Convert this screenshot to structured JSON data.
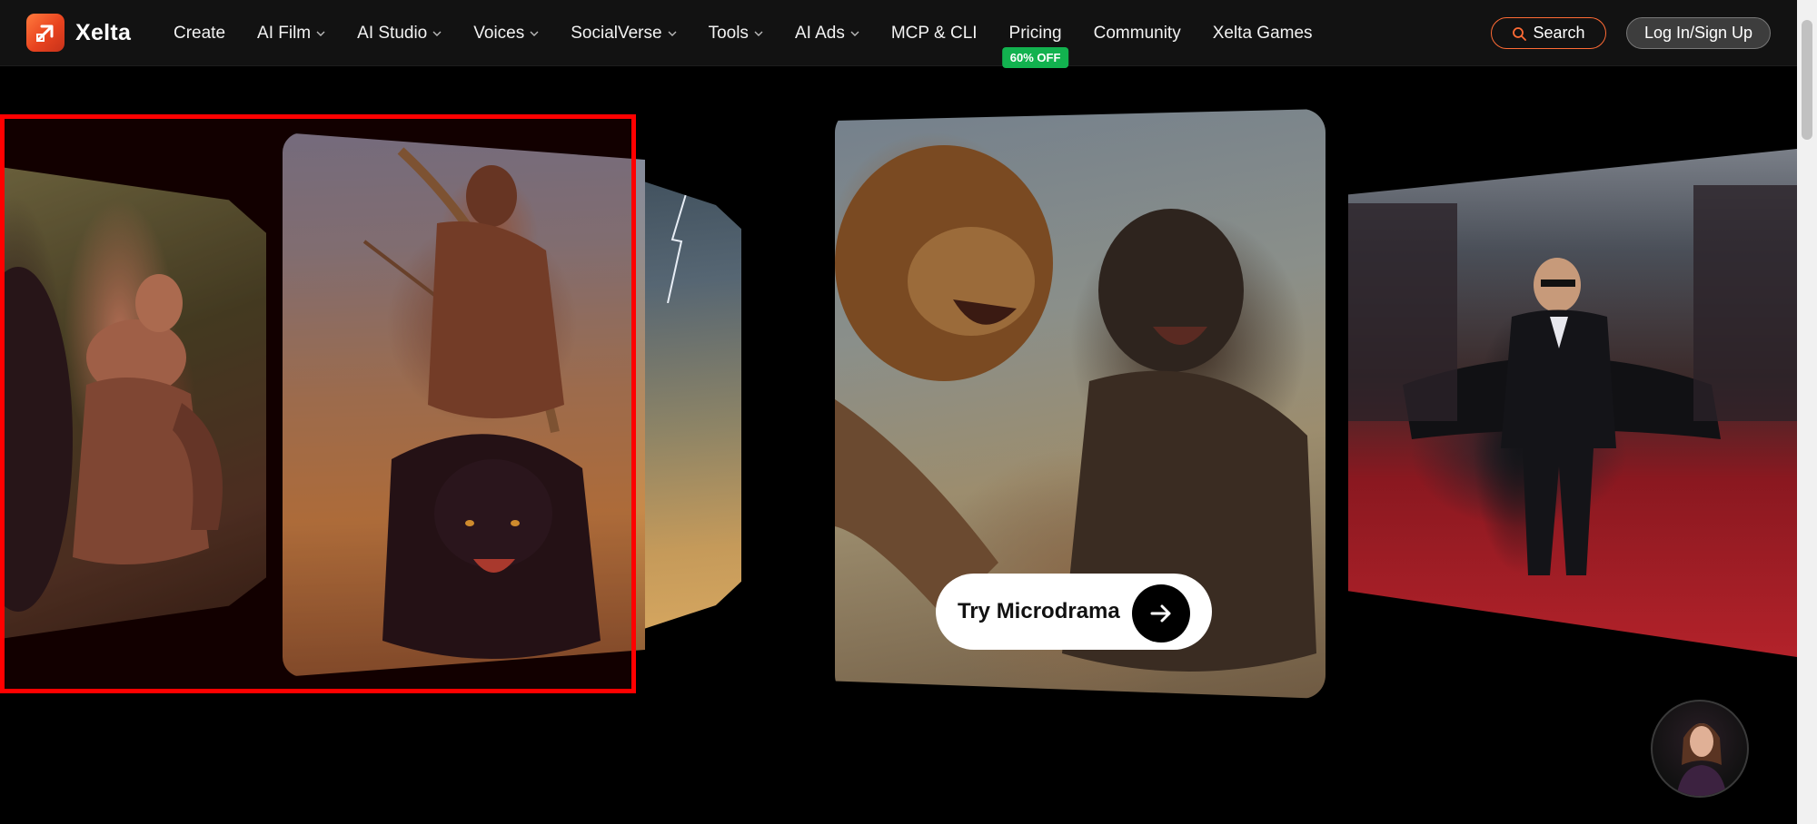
{
  "brand": {
    "name": "Xelta"
  },
  "nav": {
    "create": "Create",
    "ai_film": "AI Film",
    "ai_studio": "AI Studio",
    "voices": "Voices",
    "socialverse": "SocialVerse",
    "tools": "Tools",
    "ai_ads": "AI Ads",
    "mcp_cli": "MCP & CLI",
    "pricing": "Pricing",
    "pricing_badge": "60% OFF",
    "community": "Community",
    "games": "Xelta Games"
  },
  "header": {
    "search_label": "Search",
    "login_label": "Log In/Sign Up"
  },
  "hero": {
    "cta_label": "Try Microdrama"
  },
  "colors": {
    "accent": "#ff6b35",
    "badge": "#12b24f",
    "highlight": "#ff0000"
  }
}
